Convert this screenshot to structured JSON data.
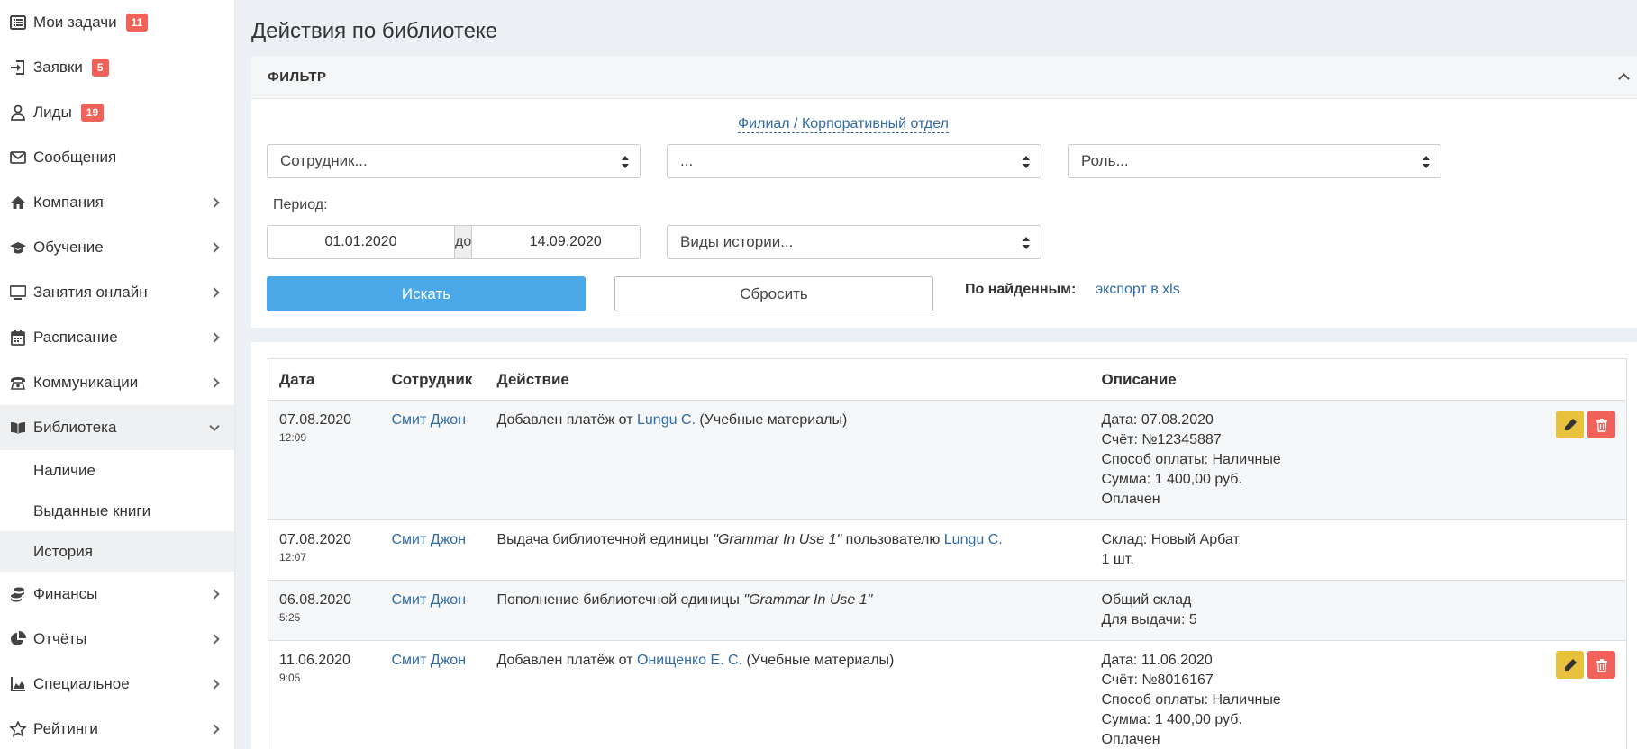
{
  "sidebar": {
    "items": [
      {
        "label": "Мои задачи",
        "badge": "11",
        "icon": "list-icon"
      },
      {
        "label": "Заявки",
        "badge": "5",
        "icon": "sign-in-icon"
      },
      {
        "label": "Лиды",
        "badge": "19",
        "icon": "user-icon"
      },
      {
        "label": "Сообщения",
        "icon": "envelope-icon"
      },
      {
        "label": "Компания",
        "icon": "home-icon"
      },
      {
        "label": "Обучение",
        "icon": "graduation-cap-icon"
      },
      {
        "label": "Занятия онлайн",
        "icon": "monitor-icon"
      },
      {
        "label": "Расписание",
        "icon": "calendar-icon"
      },
      {
        "label": "Коммуникации",
        "icon": "phone-icon"
      },
      {
        "label": "Библиотека",
        "icon": "book-icon"
      },
      {
        "label": "Финансы",
        "icon": "coins-icon"
      },
      {
        "label": "Отчёты",
        "icon": "pie-chart-icon"
      },
      {
        "label": "Специальное",
        "icon": "area-chart-icon"
      },
      {
        "label": "Рейтинги",
        "icon": "star-icon"
      }
    ],
    "library_sub": [
      "Наличие",
      "Выданные книги",
      "История"
    ]
  },
  "page": {
    "title": "Действия по библиотеке"
  },
  "filter": {
    "heading": "ФИЛЬТР",
    "branch_link": "Филиал / Корпоративный отдел",
    "employee_select": "Сотрудник...",
    "branch_select": "...",
    "role_select": "Роль...",
    "period_label": "Период:",
    "date_from": "01.01.2020",
    "date_sep": "до",
    "date_to": "14.09.2020",
    "history_types_select": "Виды истории...",
    "search_label": "Искать",
    "reset_label": "Сбросить",
    "found_label": "По найденным:",
    "export_label": "экспорт в xls"
  },
  "table": {
    "headers": {
      "date": "Дата",
      "employee": "Сотрудник",
      "action": "Действие",
      "description": "Описание"
    },
    "rows": [
      {
        "date": "07.08.2020",
        "time": "12:09",
        "employee": "Смит Джон",
        "action_pre": "Добавлен платёж от ",
        "action_link": "Lungu C.",
        "action_post": " (Учебные материалы)",
        "desc": [
          "Дата: 07.08.2020",
          "Счёт: №12345887",
          "Способ оплаты: Наличные",
          "Сумма: 1 400,00 руб.",
          "Оплачен"
        ],
        "has_actions": true
      },
      {
        "date": "07.08.2020",
        "time": "12:07",
        "employee": "Смит Джон",
        "action_pre": "Выдача библиотечной единицы ",
        "action_item": "\"Grammar In Use 1\"",
        "action_mid": " пользователю ",
        "action_link": "Lungu C.",
        "desc": [
          "Склад: Новый Арбат",
          "1 шт."
        ],
        "has_actions": false
      },
      {
        "date": "06.08.2020",
        "time": "5:25",
        "employee": "Смит Джон",
        "action_pre": "Пополнение библиотечной единицы ",
        "action_item": "\"Grammar In Use 1\"",
        "desc": [
          "Общий склад",
          "Для выдачи: 5"
        ],
        "has_actions": false
      },
      {
        "date": "11.06.2020",
        "time": "9:05",
        "employee": "Смит Джон",
        "action_pre": "Добавлен платёж от ",
        "action_link": "Онищенко Е. С.",
        "action_post": " (Учебные материалы)",
        "desc": [
          "Дата: 11.06.2020",
          "Счёт: №8016167",
          "Способ оплаты: Наличные",
          "Сумма: 1 400,00 руб.",
          "Оплачен"
        ],
        "has_actions": true
      }
    ]
  },
  "colors": {
    "accent": "#4aa7e8",
    "badge": "#f0625a",
    "edit": "#e8c23d",
    "delete": "#f0625a",
    "link": "#2f6ba7"
  }
}
